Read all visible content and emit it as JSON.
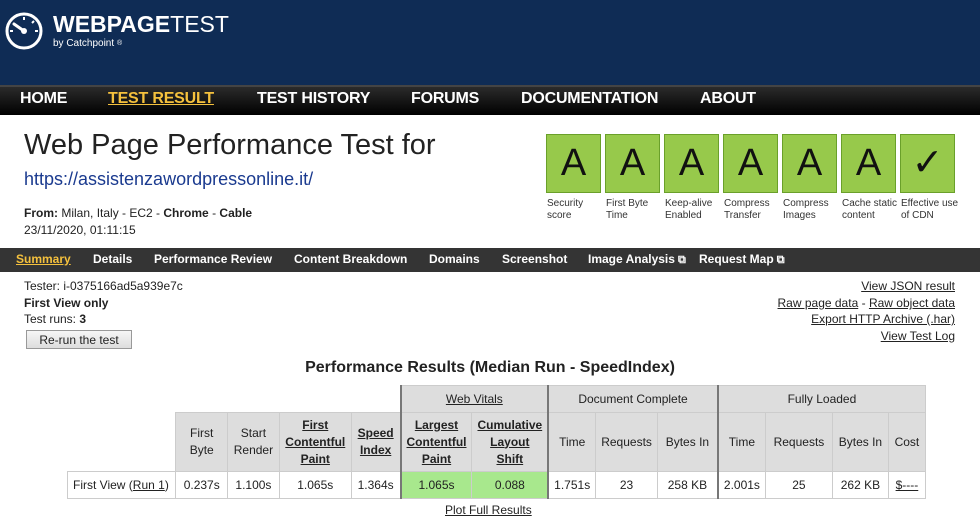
{
  "brand": {
    "logo_main_bold": "WEBPAGE",
    "logo_main_thin": "TEST",
    "logo_sub": "by Catchpoint",
    "registered": "®"
  },
  "nav": {
    "items": [
      "HOME",
      "TEST RESULT",
      "TEST HISTORY",
      "FORUMS",
      "DOCUMENTATION",
      "ABOUT"
    ],
    "active": "TEST RESULT"
  },
  "page": {
    "title": "Web Page Performance Test for",
    "url": "https://assistenzawordpressonline.it/",
    "from_label": "From:",
    "from_location": "Milan, Italy - EC2 -",
    "browser": "Chrome",
    "connection_sep": "-",
    "connection": "Cable",
    "date": "23/11/2020, 01:11:15"
  },
  "grades": [
    {
      "grade": "A",
      "label": "Security score"
    },
    {
      "grade": "A",
      "label": "First Byte Time"
    },
    {
      "grade": "A",
      "label": "Keep-alive Enabled"
    },
    {
      "grade": "A",
      "label": "Compress Transfer"
    },
    {
      "grade": "A",
      "label": "Compress Images"
    },
    {
      "grade": "A",
      "label": "Cache static content"
    },
    {
      "grade": "✓",
      "label": "Effective use of CDN"
    }
  ],
  "grade_color": "#97c94b",
  "tabs": {
    "items": [
      "Summary",
      "Details",
      "Performance Review",
      "Content Breakdown",
      "Domains",
      "Screenshot",
      "Image Analysis",
      "Request Map"
    ],
    "active": "Summary",
    "external_icon": "external-link-icon"
  },
  "test_info": {
    "tester": "Tester: i-0375166ad5a939e7c",
    "view": "First View only",
    "runs_label": "Test runs:",
    "runs_value": "3",
    "rerun_button": "Re-run the test"
  },
  "right_links": {
    "json": "View JSON result",
    "raw_page": "Raw page data",
    "separator": "-",
    "raw_object": "Raw object data",
    "har": "Export HTTP Archive (.har)",
    "log": "View Test Log"
  },
  "performance": {
    "title": "Performance Results (Median Run - SpeedIndex)",
    "groups": {
      "web_vitals": "Web Vitals",
      "document_complete": "Document Complete",
      "fully_loaded": "Fully Loaded"
    },
    "columns": {
      "first_byte": "First Byte",
      "start_render": "Start Render",
      "fcp": "First Contentful Paint",
      "speed_index": "Speed Index",
      "lcp": "Largest Contentful Paint",
      "cls": "Cumulative Layout Shift",
      "time": "Time",
      "requests": "Requests",
      "bytes_in": "Bytes In",
      "cost": "Cost"
    },
    "row": {
      "label": "First View (",
      "run_link": "Run 1",
      "label_end": ")",
      "first_byte": "0.237s",
      "start_render": "1.100s",
      "fcp": "1.065s",
      "speed_index": "1.364s",
      "lcp": "1.065s",
      "cls": "0.088",
      "doc_time": "1.751s",
      "doc_requests": "23",
      "doc_bytes": "258 KB",
      "full_time": "2.001s",
      "full_requests": "25",
      "full_bytes": "262 KB",
      "cost": "$----"
    },
    "vital_color": "#a8e88d",
    "plot_link": "Plot Full Results"
  }
}
